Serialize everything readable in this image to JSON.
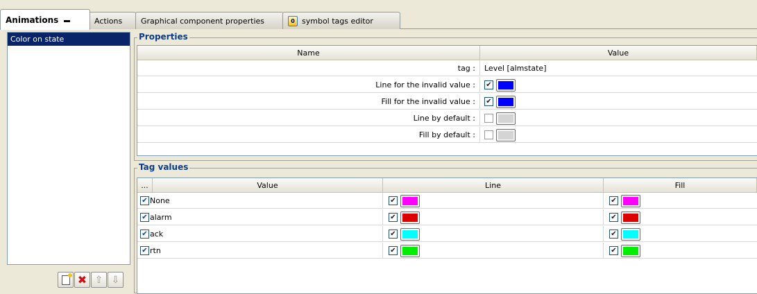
{
  "tabs": [
    {
      "label": "Animations",
      "active": true
    },
    {
      "label": "Actions",
      "active": false
    },
    {
      "label": "Graphical component properties",
      "active": false
    },
    {
      "label": "symbol tags editor",
      "active": false
    }
  ],
  "animation_list": {
    "items": [
      "Color on state"
    ]
  },
  "properties": {
    "title": "Properties",
    "columns": {
      "name": "Name",
      "value": "Value"
    },
    "rows": [
      {
        "name": "tag :",
        "value_text": "Level [almstate]"
      },
      {
        "name": "Line for the invalid value :",
        "checked": true,
        "color": "#0000ff"
      },
      {
        "name": "Fill for the invalid value :",
        "checked": true,
        "color": "#0000ff"
      },
      {
        "name": "Line by default :",
        "checked": false,
        "color": "#d4d4d4"
      },
      {
        "name": "Fill by default :",
        "checked": false,
        "color": "#d4d4d4"
      }
    ]
  },
  "tag_values": {
    "title": "Tag values",
    "columns": {
      "sel": "...",
      "value": "Value",
      "line": "Line",
      "fill": "Fill"
    },
    "rows": [
      {
        "value": "None",
        "line_color": "#ff00ff",
        "fill_color": "#ff00ff"
      },
      {
        "value": "alarm",
        "line_color": "#dd0000",
        "fill_color": "#dd0000"
      },
      {
        "value": "ack",
        "line_color": "#00ffff",
        "fill_color": "#00ffff"
      },
      {
        "value": "rtn",
        "line_color": "#00ee00",
        "fill_color": "#00ee00"
      }
    ]
  },
  "icons": {
    "tab_doc": "symbol-tags-editor-icon",
    "new": "new-animation-icon",
    "delete": "delete-animation-icon",
    "up": "move-up-icon",
    "down": "move-down-icon"
  }
}
